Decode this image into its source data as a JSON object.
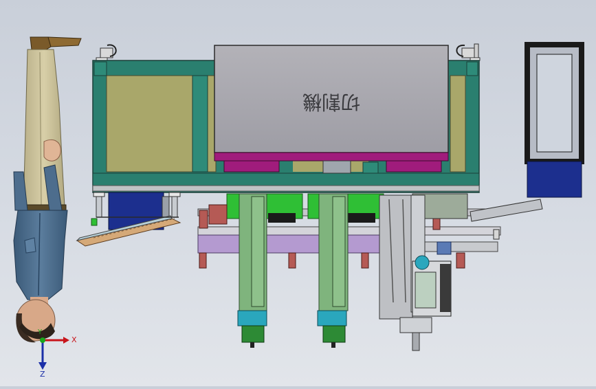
{
  "scene": {
    "machine_label": "切割機",
    "label_orientation": "mirrored-upside-down",
    "background_color": "#cfd5de",
    "view_note_visible": false
  },
  "colors": {
    "frame_teal": "#2a7f6f",
    "panel_olive": "#a9a76a",
    "lid_gray": "#a7a6ad",
    "magenta": "#a01c7c",
    "motor_navy": "#1c2f8e",
    "slide_green": "#7fb47d",
    "bright_green": "#2fbf35",
    "rail_purple": "#b49ad0",
    "brick_red": "#b55a55",
    "cyan": "#2aa7bd"
  },
  "axes": {
    "x_label": "X",
    "y_label": "Y",
    "z_label": "Z",
    "x_color": "#c8151b",
    "y_color": "#1aa51a",
    "z_color": "#1b2fa8"
  },
  "icons": {
    "triad": "coordinate-triad-icon",
    "human": "human-scale-figure"
  }
}
